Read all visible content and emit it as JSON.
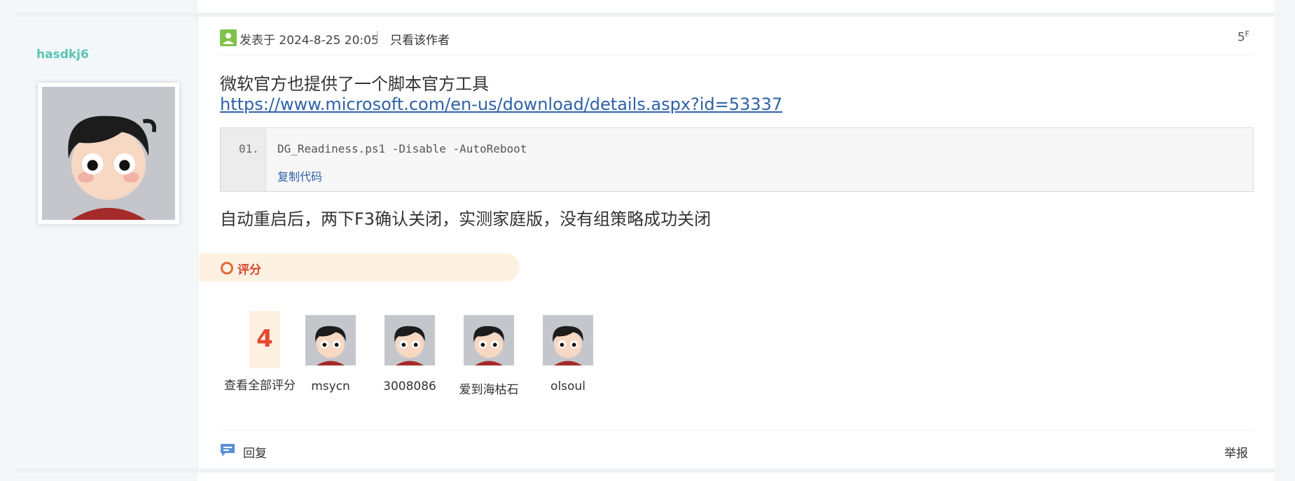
{
  "author": {
    "name": "hasdkj6"
  },
  "post": {
    "posted_at": "发表于 2024-8-25 20:05",
    "separator": "|",
    "only_author": "只看该作者",
    "floor": "5",
    "floor_suffix": "F",
    "line1": "微软官方也提供了一个脚本官方工具",
    "link": "https://www.microsoft.com/en-us/download/details.aspx?id=53337",
    "code": {
      "line_number": "01.",
      "text": "DG_Readiness.ps1 -Disable -AutoReboot",
      "copy_label": "复制代码"
    },
    "line2": "自动重启后，两下F3确认关闭，实测家庭版，没有组策略成功关闭"
  },
  "rating": {
    "label": "评分",
    "score": "4",
    "view_all": "查看全部评分",
    "raters": [
      "msycn",
      "3008086",
      "爱到海枯石",
      "olsoul"
    ]
  },
  "footer": {
    "reply": "回复",
    "report": "举报"
  },
  "colors": {
    "author_name": "#5ac4b2",
    "link": "#2f61a7",
    "score": "#e8462e",
    "rating_bar": "#fdf1e2"
  }
}
